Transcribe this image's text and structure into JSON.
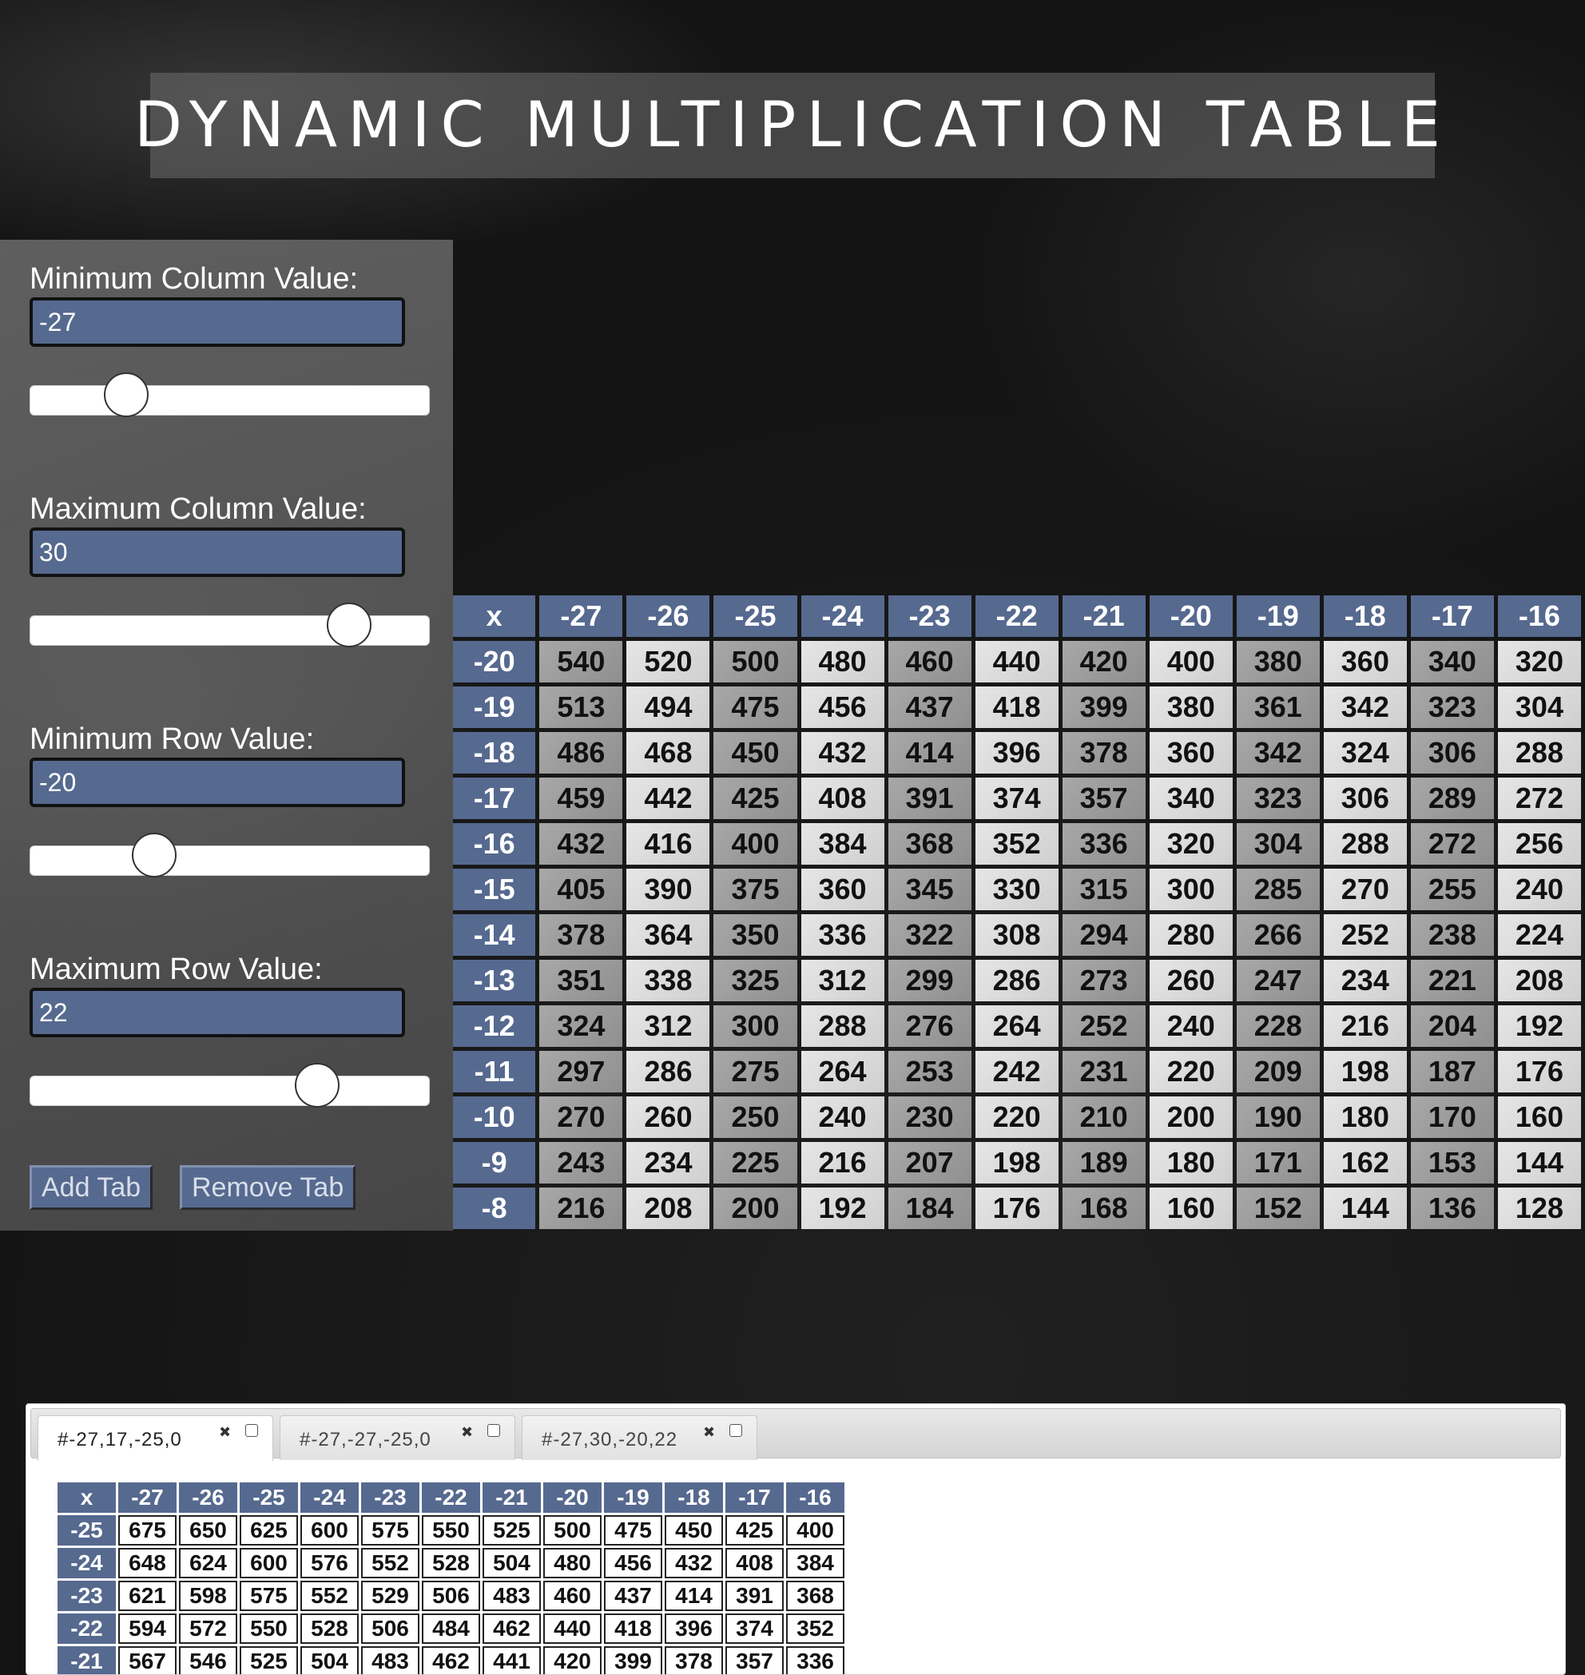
{
  "page_title": "DYNAMIC MULTIPLICATION TABLE",
  "controls": {
    "min_col": {
      "label": "Minimum Column Value:",
      "value": "-27",
      "slider_fraction": 0.24
    },
    "max_col": {
      "label": "Maximum Column Value:",
      "value": "30",
      "slider_fraction": 0.8
    },
    "min_row": {
      "label": "Minimum Row Value:",
      "value": "-20",
      "slider_fraction": 0.31
    },
    "max_row": {
      "label": "Maximum Row Value:",
      "value": "22",
      "slider_fraction": 0.72
    }
  },
  "buttons": {
    "add_tab": "Add Tab",
    "remove_tab": "Remove Tab"
  },
  "main_table": {
    "corner": "x",
    "columns": [
      "-27",
      "-26",
      "-25",
      "-24",
      "-23",
      "-22",
      "-21",
      "-20",
      "-19",
      "-18",
      "-17",
      "-16"
    ],
    "rows": [
      {
        "label": "-20",
        "cells": [
          "540",
          "520",
          "500",
          "480",
          "460",
          "440",
          "420",
          "400",
          "380",
          "360",
          "340",
          "320"
        ]
      },
      {
        "label": "-19",
        "cells": [
          "513",
          "494",
          "475",
          "456",
          "437",
          "418",
          "399",
          "380",
          "361",
          "342",
          "323",
          "304"
        ]
      },
      {
        "label": "-18",
        "cells": [
          "486",
          "468",
          "450",
          "432",
          "414",
          "396",
          "378",
          "360",
          "342",
          "324",
          "306",
          "288"
        ]
      },
      {
        "label": "-17",
        "cells": [
          "459",
          "442",
          "425",
          "408",
          "391",
          "374",
          "357",
          "340",
          "323",
          "306",
          "289",
          "272"
        ]
      },
      {
        "label": "-16",
        "cells": [
          "432",
          "416",
          "400",
          "384",
          "368",
          "352",
          "336",
          "320",
          "304",
          "288",
          "272",
          "256"
        ]
      },
      {
        "label": "-15",
        "cells": [
          "405",
          "390",
          "375",
          "360",
          "345",
          "330",
          "315",
          "300",
          "285",
          "270",
          "255",
          "240"
        ]
      },
      {
        "label": "-14",
        "cells": [
          "378",
          "364",
          "350",
          "336",
          "322",
          "308",
          "294",
          "280",
          "266",
          "252",
          "238",
          "224"
        ]
      },
      {
        "label": "-13",
        "cells": [
          "351",
          "338",
          "325",
          "312",
          "299",
          "286",
          "273",
          "260",
          "247",
          "234",
          "221",
          "208"
        ]
      },
      {
        "label": "-12",
        "cells": [
          "324",
          "312",
          "300",
          "288",
          "276",
          "264",
          "252",
          "240",
          "228",
          "216",
          "204",
          "192"
        ]
      },
      {
        "label": "-11",
        "cells": [
          "297",
          "286",
          "275",
          "264",
          "253",
          "242",
          "231",
          "220",
          "209",
          "198",
          "187",
          "176"
        ]
      },
      {
        "label": "-10",
        "cells": [
          "270",
          "260",
          "250",
          "240",
          "230",
          "220",
          "210",
          "200",
          "190",
          "180",
          "170",
          "160"
        ]
      },
      {
        "label": "-9",
        "cells": [
          "243",
          "234",
          "225",
          "216",
          "207",
          "198",
          "189",
          "180",
          "171",
          "162",
          "153",
          "144"
        ]
      },
      {
        "label": "-8",
        "cells": [
          "216",
          "208",
          "200",
          "192",
          "184",
          "176",
          "168",
          "160",
          "152",
          "144",
          "136",
          "128"
        ]
      }
    ]
  },
  "tabs": [
    {
      "label": "#-27,17,-25,0",
      "close": "✖",
      "active": true
    },
    {
      "label": "#-27,-27,-25,0",
      "close": "✖",
      "active": false
    },
    {
      "label": "#-27,30,-20,22",
      "close": "✖",
      "active": false
    }
  ],
  "tab_table": {
    "corner": "x",
    "columns": [
      "-27",
      "-26",
      "-25",
      "-24",
      "-23",
      "-22",
      "-21",
      "-20",
      "-19",
      "-18",
      "-17",
      "-16"
    ],
    "rows": [
      {
        "label": "-25",
        "cells": [
          "675",
          "650",
          "625",
          "600",
          "575",
          "550",
          "525",
          "500",
          "475",
          "450",
          "425",
          "400"
        ]
      },
      {
        "label": "-24",
        "cells": [
          "648",
          "624",
          "600",
          "576",
          "552",
          "528",
          "504",
          "480",
          "456",
          "432",
          "408",
          "384"
        ]
      },
      {
        "label": "-23",
        "cells": [
          "621",
          "598",
          "575",
          "552",
          "529",
          "506",
          "483",
          "460",
          "437",
          "414",
          "391",
          "368"
        ]
      },
      {
        "label": "-22",
        "cells": [
          "594",
          "572",
          "550",
          "528",
          "506",
          "484",
          "462",
          "440",
          "418",
          "396",
          "374",
          "352"
        ]
      },
      {
        "label": "-21",
        "cells": [
          "567",
          "546",
          "525",
          "504",
          "483",
          "462",
          "441",
          "420",
          "399",
          "378",
          "357",
          "336"
        ]
      }
    ]
  },
  "colors": {
    "accent": "#56698f",
    "cell_dark": "#9a9a9a",
    "cell_light": "#dcdcdc"
  }
}
